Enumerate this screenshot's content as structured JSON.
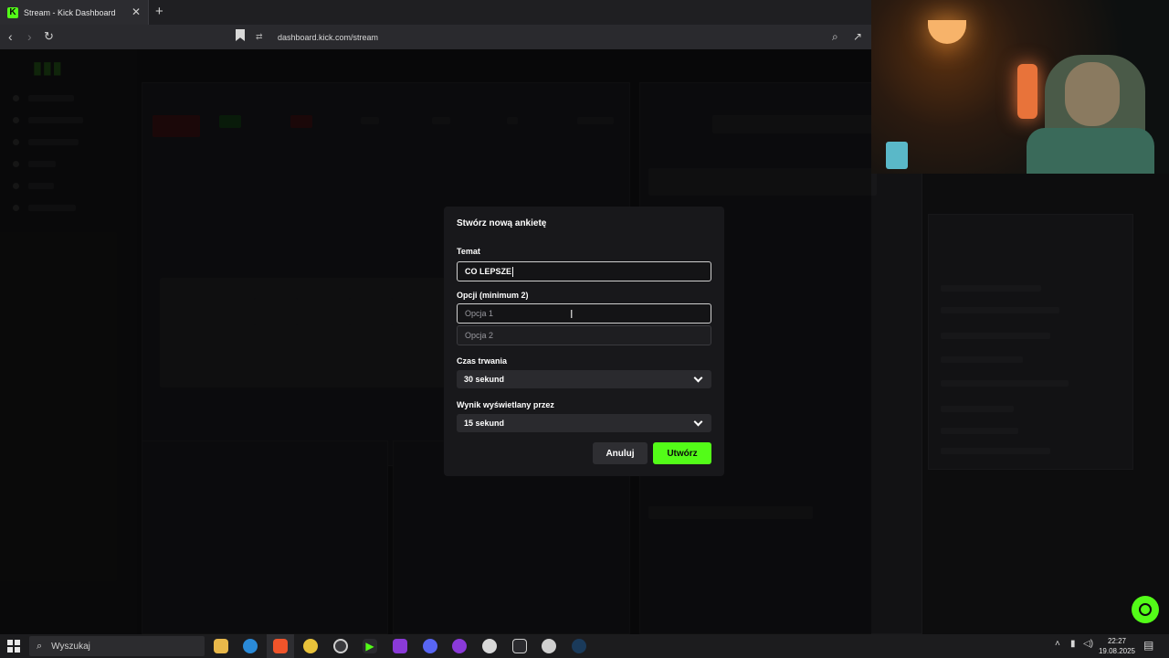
{
  "browser": {
    "tab_title": "Stream - Kick Dashboard",
    "favicon_letter": "K",
    "url": "dashboard.kick.com/stream"
  },
  "modal": {
    "title": "Stwórz nową ankietę",
    "topic_label": "Temat",
    "topic_value": "CO LEPSZE",
    "options_label": "Opcji (minimum 2)",
    "option1_placeholder": "Opcja 1",
    "option2_placeholder": "Opcja 2",
    "duration_label": "Czas trwania",
    "duration_value": "30 sekund",
    "result_label": "Wynik wyświetlany przez",
    "result_value": "15 sekund",
    "cancel_label": "Anuluj",
    "create_label": "Utwórz"
  },
  "taskbar": {
    "search_placeholder": "Wyszukaj",
    "time": "22:27",
    "date": "19.08.2025"
  },
  "colors": {
    "accent": "#53fc18",
    "modal_bg": "#18181b"
  }
}
